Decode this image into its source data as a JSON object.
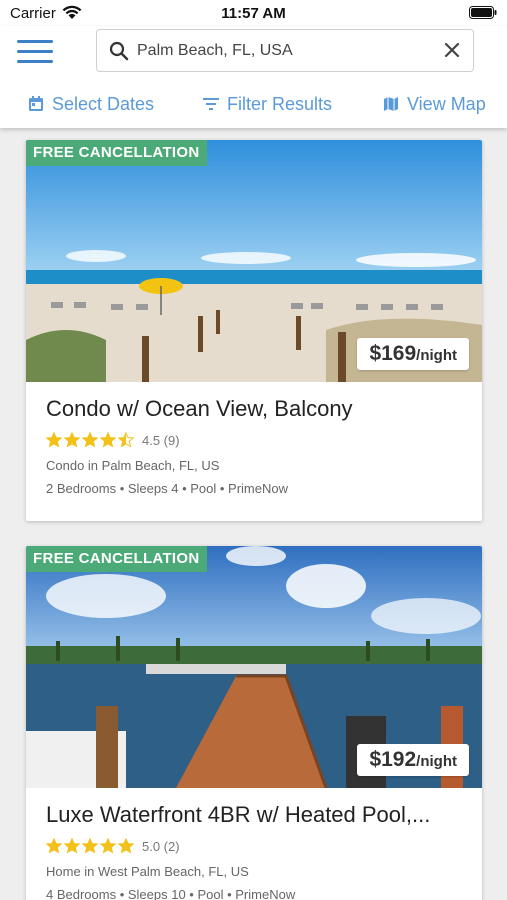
{
  "status": {
    "carrier": "Carrier",
    "time": "11:57 AM"
  },
  "search": {
    "query": "Palm Beach, FL, USA"
  },
  "toolbar": {
    "select_dates": "Select Dates",
    "filter_results": "Filter Results",
    "view_map": "View Map"
  },
  "colors": {
    "accent": "#5a9ad8",
    "menu": "#3c80c8",
    "badge": "#4caa78",
    "star": "#f2c21b"
  },
  "listings": [
    {
      "badge": "FREE CANCELLATION",
      "price": "$169",
      "price_unit": "/night",
      "title": "Condo w/ Ocean View, Balcony",
      "rating": 4.5,
      "rating_text": "4.5 (9)",
      "location": "Condo in Palm Beach, FL, US",
      "features": "2 Bedrooms  •  Sleeps 4  •  Pool  •  PrimeNow"
    },
    {
      "badge": "FREE CANCELLATION",
      "price": "$192",
      "price_unit": "/night",
      "title": "Luxe Waterfront 4BR w/ Heated Pool,...",
      "rating": 5.0,
      "rating_text": "5.0 (2)",
      "location": "Home in West Palm Beach, FL, US",
      "features": "4 Bedrooms  •  Sleeps 10  •  Pool  •  PrimeNow"
    }
  ]
}
